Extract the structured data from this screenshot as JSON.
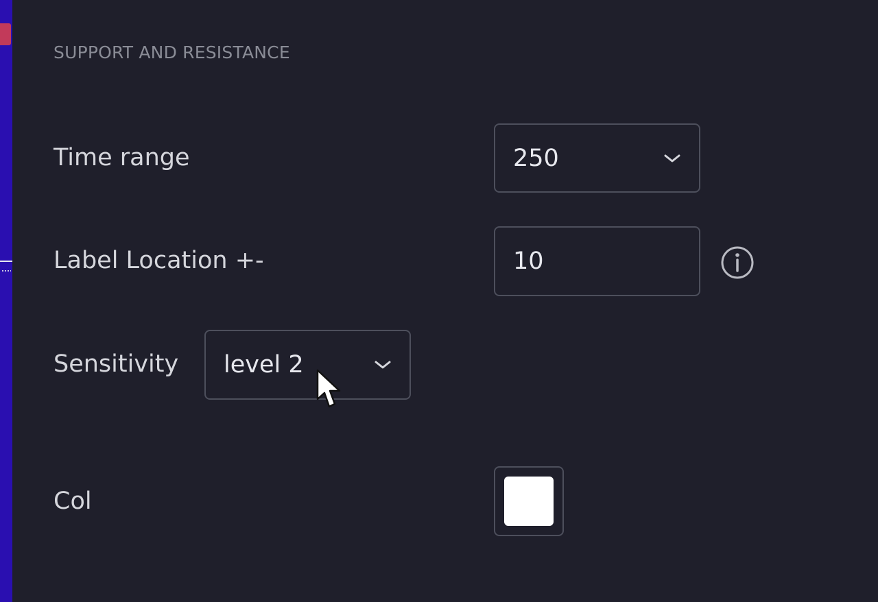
{
  "section": {
    "title": "SUPPORT AND RESISTANCE"
  },
  "fields": {
    "time_range": {
      "label": "Time range",
      "value": "250",
      "control": "dropdown"
    },
    "label_location": {
      "label": "Label Location +-",
      "value": "10",
      "control": "number-input",
      "info_icon": "info-icon"
    },
    "sensitivity": {
      "label": "Sensitivity",
      "value": "level 2",
      "control": "dropdown"
    },
    "color": {
      "label": "Col",
      "swatch_color": "#ffffff",
      "control": "color-picker"
    }
  },
  "colors": {
    "background": "#1f1f2b",
    "left_strip": "#2a0fb0",
    "left_strip_marker": "#c23a5a",
    "border": "#4d4f5c",
    "label_text": "#d5d6dc",
    "section_text": "#8a8c96"
  },
  "icons": {
    "dropdown": "chevron-down-icon",
    "info": "info-icon",
    "cursor": "mouse-pointer-icon"
  }
}
